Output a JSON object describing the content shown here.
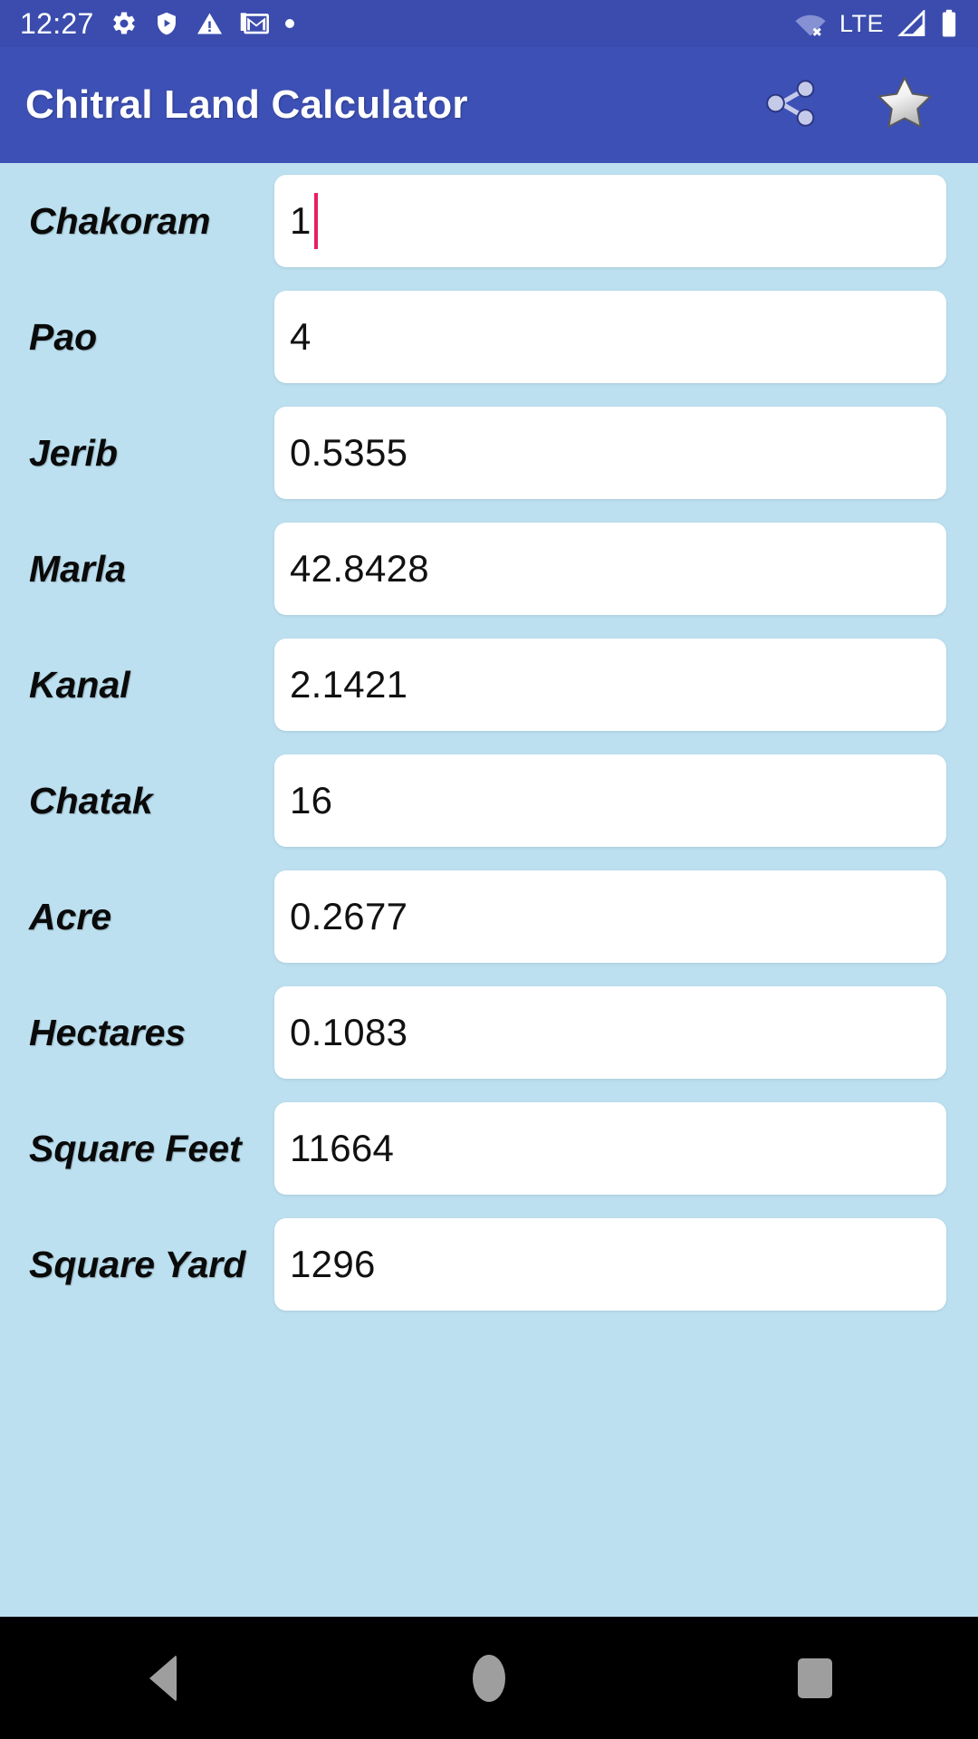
{
  "status_bar": {
    "time": "12:27",
    "left_icons": [
      "gear-icon",
      "play-protect-shield-icon",
      "warning-triangle-icon",
      "gmail-icon",
      "more-dot-icon"
    ],
    "network_label": "LTE",
    "right_icons": [
      "wifi-off-icon",
      "cellular-signal-icon",
      "battery-full-icon"
    ],
    "background_color": "#3B4CAE"
  },
  "app_bar": {
    "title": "Chitral Land Calculator",
    "share_label": "Share",
    "favorite_label": "Favorite",
    "background_color": "#3D50B5",
    "title_color": "#FFFFFF"
  },
  "theme": {
    "page_background": "#BCE0F0",
    "field_background": "#FFFFFF",
    "caret_color": "#E91E63",
    "label_color": "#0A0A0A"
  },
  "converter": {
    "units": [
      {
        "label": "Chakoram",
        "value": "1",
        "focused": true
      },
      {
        "label": "Pao",
        "value": "4",
        "focused": false
      },
      {
        "label": "Jerib",
        "value": "0.5355",
        "focused": false
      },
      {
        "label": "Marla",
        "value": "42.8428",
        "focused": false
      },
      {
        "label": "Kanal",
        "value": "2.1421",
        "focused": false
      },
      {
        "label": "Chatak",
        "value": "16",
        "focused": false
      },
      {
        "label": "Acre",
        "value": "0.2677",
        "focused": false
      },
      {
        "label": "Hectares",
        "value": "0.1083",
        "focused": false
      },
      {
        "label": "Square Feet",
        "value": "11664",
        "focused": false
      },
      {
        "label": "Square Yard",
        "value": "1296",
        "focused": false
      }
    ]
  },
  "nav_bar": {
    "back_label": "Back",
    "home_label": "Home",
    "recents_label": "Recents",
    "background_color": "#000000"
  }
}
